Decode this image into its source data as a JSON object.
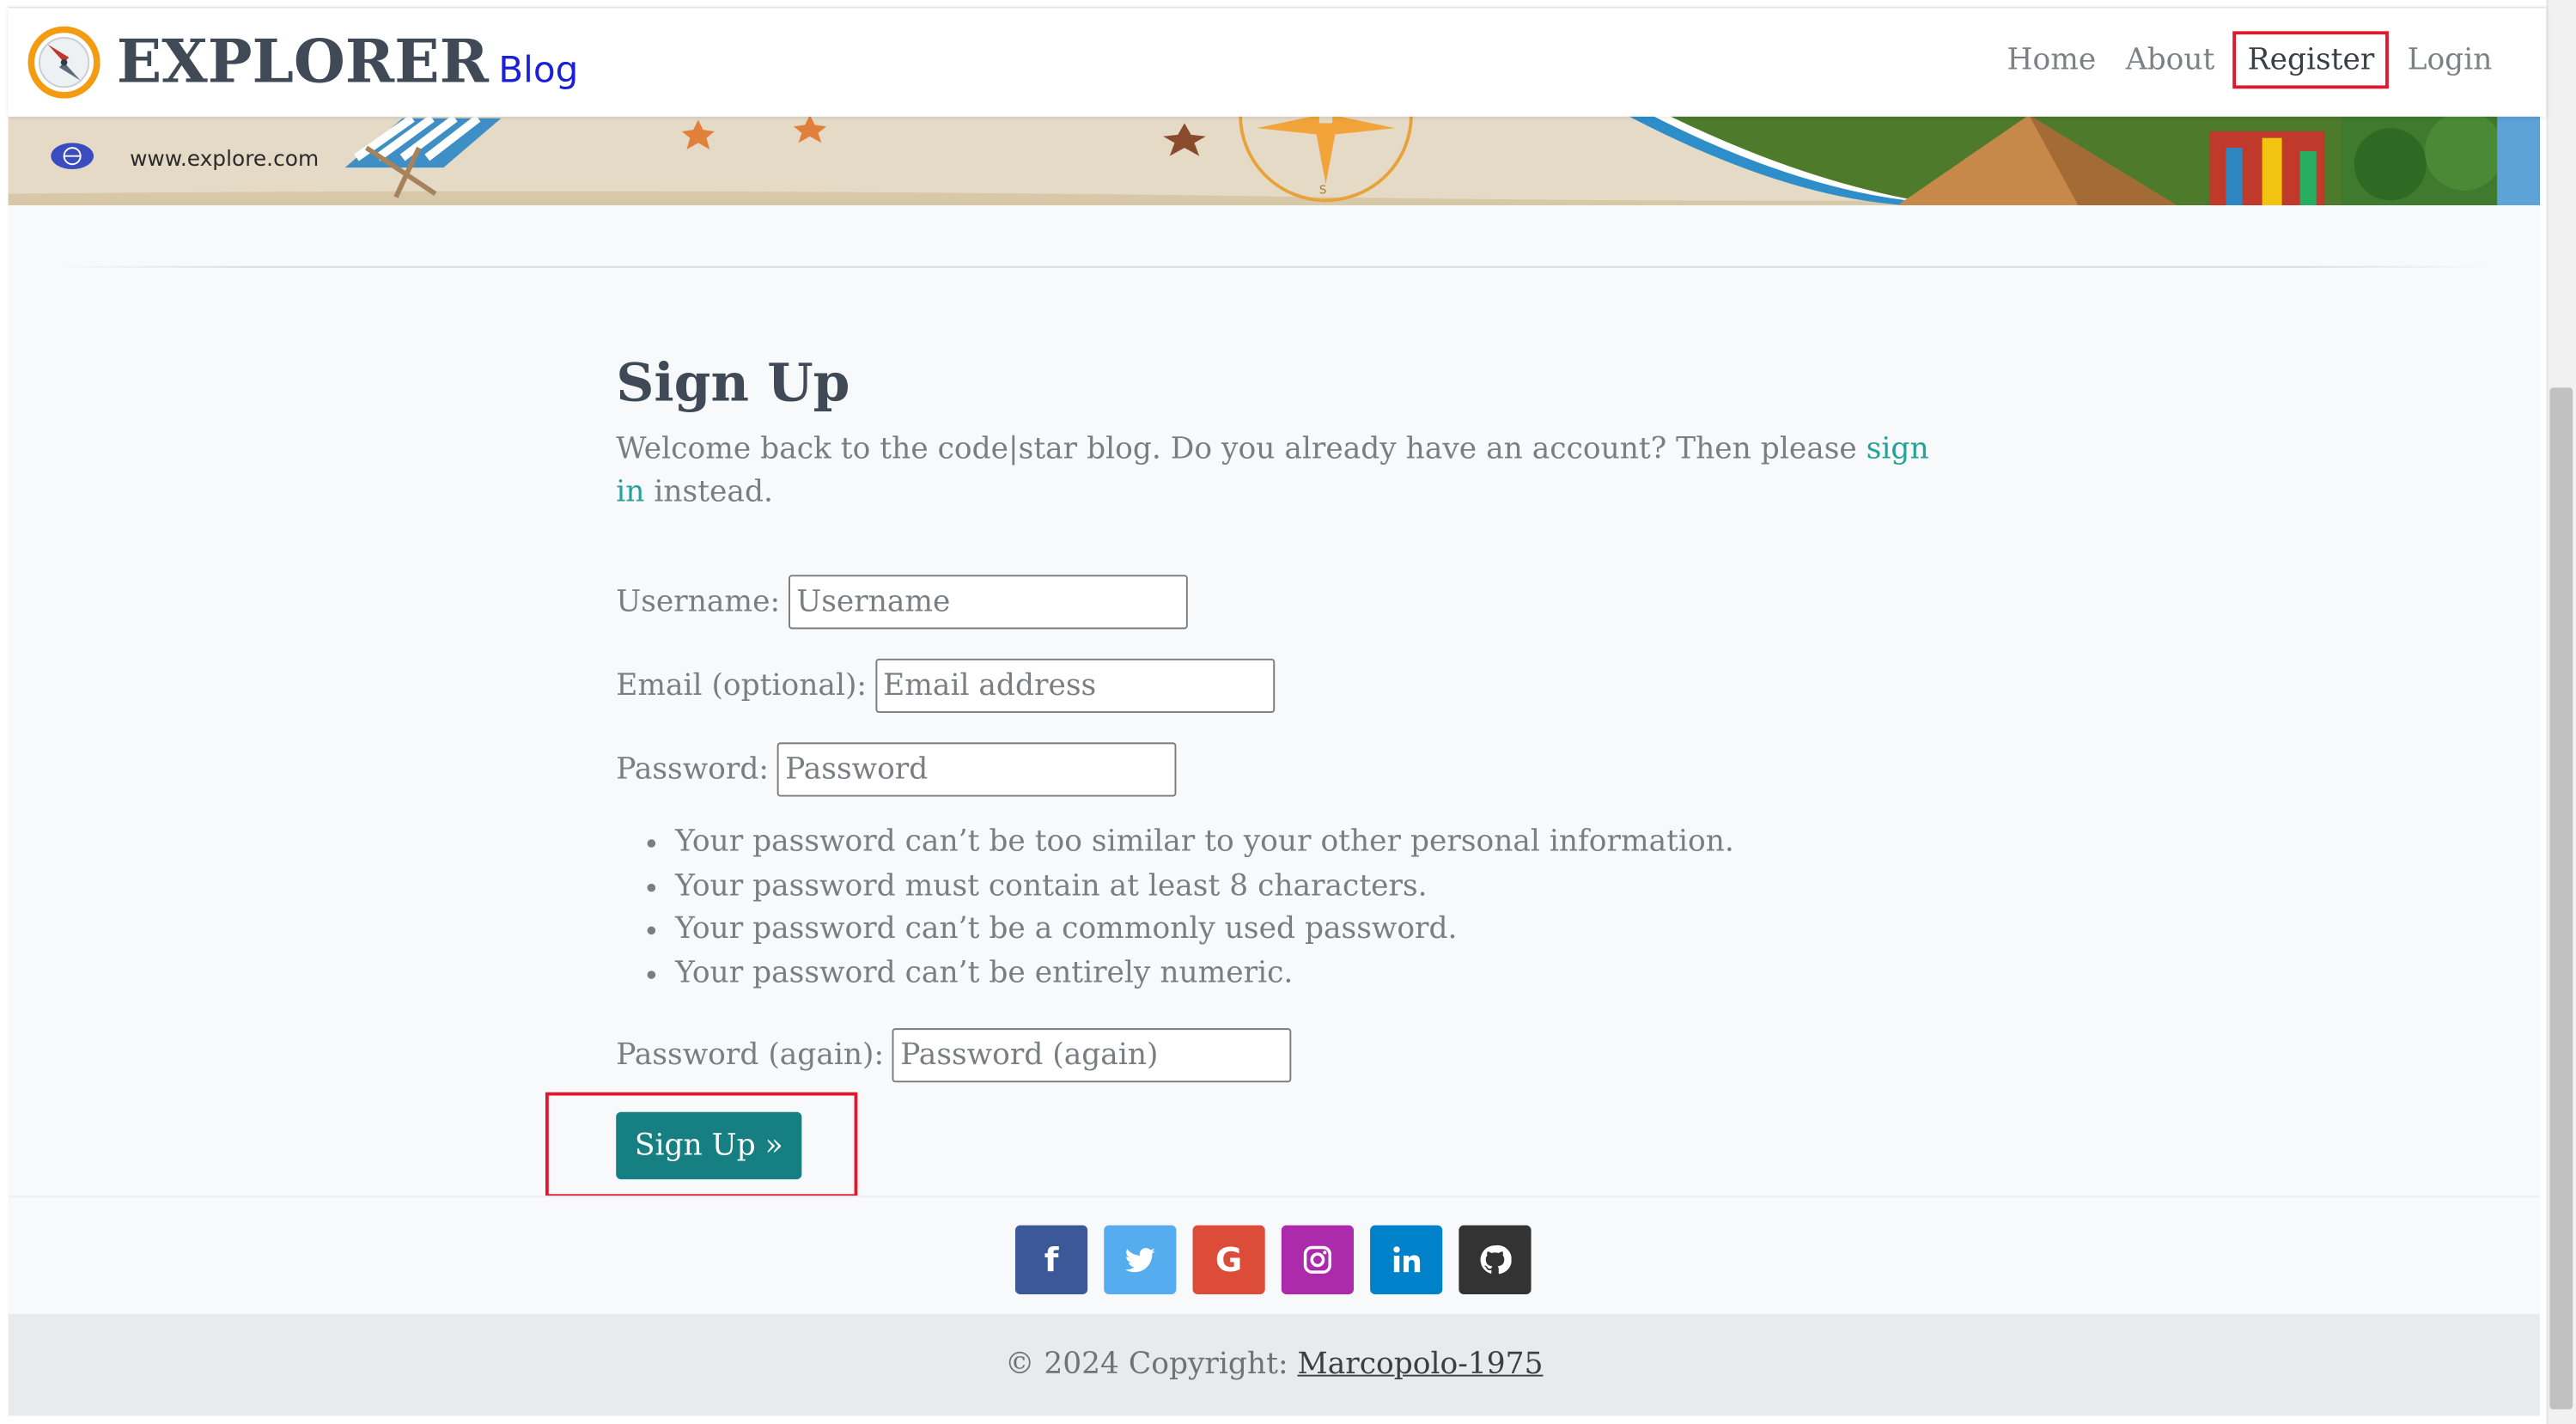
{
  "navbar": {
    "brand_name": "EXPLORER",
    "brand_sub": "Blog",
    "links": {
      "home": "Home",
      "about": "About",
      "register": "Register",
      "login": "Login"
    },
    "active_link": "register"
  },
  "banner": {
    "url_text": "www.explore.com"
  },
  "signup": {
    "title": "Sign Up",
    "intro_text": "Welcome back to the code|star blog. Do you already have an account? Then please ",
    "intro_link": "sign in",
    "intro_tail": " instead.",
    "fields": {
      "username_label": "Username:",
      "username_placeholder": "Username",
      "email_label": "Email (optional):",
      "email_placeholder": "Email address",
      "password_label": "Password:",
      "password_placeholder": "Password",
      "password2_label": "Password (again):",
      "password2_placeholder": "Password (again)"
    },
    "password_rules": [
      "Your password can’t be too similar to your other personal information.",
      "Your password must contain at least 8 characters.",
      "Your password can’t be a commonly used password.",
      "Your password can’t be entirely numeric."
    ],
    "submit_label": "Sign Up »"
  },
  "footer": {
    "social": [
      {
        "name": "facebook",
        "icon": "facebook-icon",
        "color": "#3b5998"
      },
      {
        "name": "twitter",
        "icon": "twitter-icon",
        "color": "#55acee"
      },
      {
        "name": "google",
        "icon": "google-icon",
        "color": "#dd4b39"
      },
      {
        "name": "instagram",
        "icon": "instagram-icon",
        "color": "#ac2bac"
      },
      {
        "name": "linkedin",
        "icon": "linkedin-icon",
        "color": "#0082ca"
      },
      {
        "name": "github",
        "icon": "github-icon",
        "color": "#333333"
      }
    ],
    "copyright": "© 2024 Copyright: ",
    "author": "Marcopolo-1975"
  },
  "colors": {
    "accent": "#157f81",
    "link": "#22a39a",
    "brand_sub": "#1b1fd8",
    "highlight": "#e0182d"
  }
}
